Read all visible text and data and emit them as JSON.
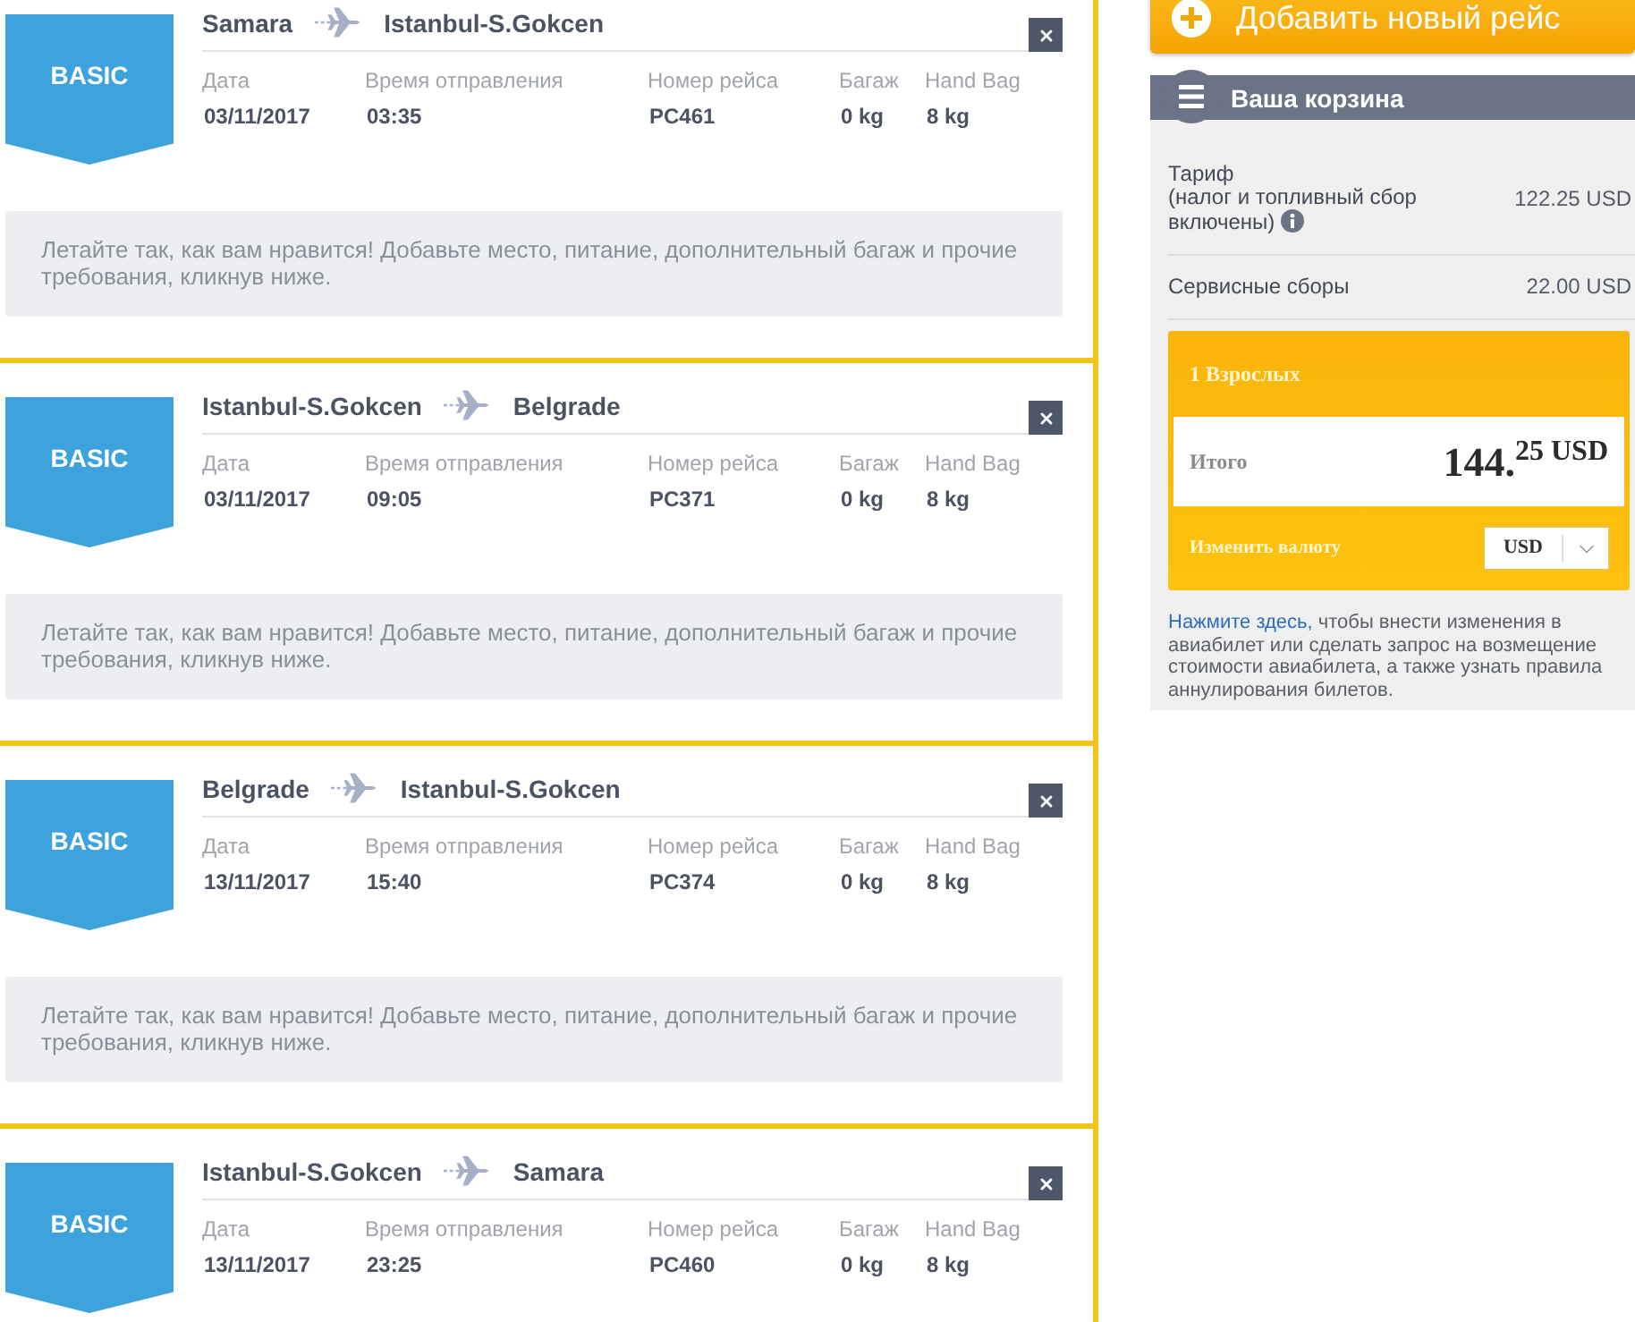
{
  "flights": [
    {
      "fare": "BASIC",
      "origin": "Samara",
      "destination": "Istanbul-S.Gokcen",
      "details": [
        {
          "label": "Дата",
          "value": "03/11/2017"
        },
        {
          "label": "Время отправления",
          "value": "03:35"
        },
        {
          "label": "Номер рейса",
          "value": "PC461"
        },
        {
          "label": "Багаж",
          "value": "0 kg"
        },
        {
          "label": "Hand Bag",
          "value": "8 kg"
        }
      ],
      "note": "Летайте так, как вам нравится! Добавьте место, питание, дополнительный багаж и прочие требования, кликнув ниже."
    },
    {
      "fare": "BASIC",
      "origin": "Istanbul-S.Gokcen",
      "destination": "Belgrade",
      "details": [
        {
          "label": "Дата",
          "value": "03/11/2017"
        },
        {
          "label": "Время отправления",
          "value": "09:05"
        },
        {
          "label": "Номер рейса",
          "value": "PC371"
        },
        {
          "label": "Багаж",
          "value": "0 kg"
        },
        {
          "label": "Hand Bag",
          "value": "8 kg"
        }
      ],
      "note": "Летайте так, как вам нравится! Добавьте место, питание, дополнительный багаж и прочие требования, кликнув ниже."
    },
    {
      "fare": "BASIC",
      "origin": "Belgrade",
      "destination": "Istanbul-S.Gokcen",
      "details": [
        {
          "label": "Дата",
          "value": "13/11/2017"
        },
        {
          "label": "Время отправления",
          "value": "15:40"
        },
        {
          "label": "Номер рейса",
          "value": "PC374"
        },
        {
          "label": "Багаж",
          "value": "0 kg"
        },
        {
          "label": "Hand Bag",
          "value": "8 kg"
        }
      ],
      "note": "Летайте так, как вам нравится! Добавьте место, питание, дополнительный багаж и прочие требования, кликнув ниже."
    },
    {
      "fare": "BASIC",
      "origin": "Istanbul-S.Gokcen",
      "destination": "Samara",
      "details": [
        {
          "label": "Дата",
          "value": "13/11/2017"
        },
        {
          "label": "Время отправления",
          "value": "23:25"
        },
        {
          "label": "Номер рейса",
          "value": "PC460"
        },
        {
          "label": "Багаж",
          "value": "0 kg"
        },
        {
          "label": "Hand Bag",
          "value": "8 kg"
        }
      ]
    }
  ],
  "add_flight_button": {
    "label": "Добавить новый рейс"
  },
  "cart": {
    "title": "Ваша корзина",
    "charges": [
      {
        "label": "Тариф",
        "sublabel": "(налог и топливный сбор включены)",
        "info": true,
        "value": "122.25 USD"
      },
      {
        "label": "Сервисные сборы",
        "value": "22.00 USD"
      }
    ],
    "summary": {
      "passengers": "1 Взрослых",
      "total_label": "Итого",
      "total": "144.$^{25 USD}$",
      "currency_label": "Изменить валюту",
      "currency_select": {
        "value": "USD"
      }
    },
    "help": {
      "link": "Нажмите здесь,",
      "text": "чтобы внести изменения в авиабилет или сделать запрос на возмещение стоимости авиабилета, а также узнать правила аннулирования билетов."
    }
  }
}
